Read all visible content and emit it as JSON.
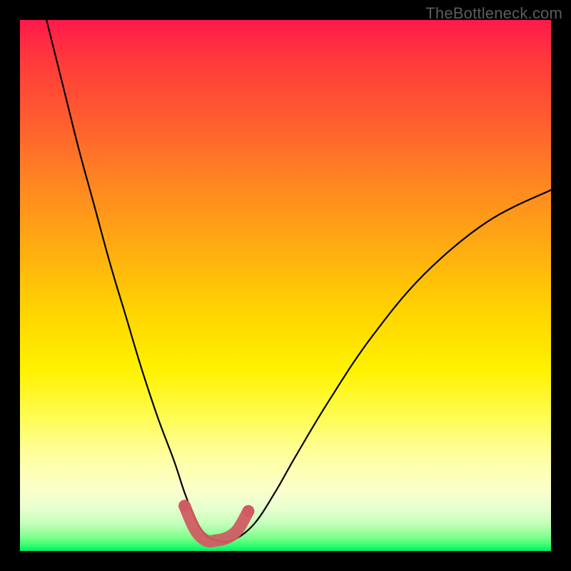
{
  "watermark": "TheBottleneck.com",
  "chart_data": {
    "type": "line",
    "title": "",
    "xlabel": "",
    "ylabel": "",
    "xlim": [
      0,
      100
    ],
    "ylim": [
      0,
      100
    ],
    "grid": false,
    "background_gradient": {
      "top": "#ff1a4b",
      "mid": "#fff200",
      "bottom": "#00e86a"
    },
    "series": [
      {
        "name": "bottleneck-curve",
        "x": [
          5,
          8,
          11,
          14,
          17,
          20,
          23,
          26,
          29,
          31,
          33,
          35,
          37,
          40,
          44,
          48,
          52,
          58,
          66,
          76,
          88,
          100
        ],
        "values": [
          100,
          88,
          76,
          65,
          54,
          44,
          34,
          25,
          17,
          11,
          6,
          3,
          2,
          2,
          5,
          11,
          18,
          28,
          40,
          52,
          62,
          68
        ]
      }
    ],
    "markers": {
      "name": "highlight-valley",
      "x": [
        31,
        33,
        35,
        37,
        39,
        41,
        43
      ],
      "values": [
        8.5,
        4.0,
        2.0,
        2.0,
        2.5,
        4.0,
        7.5
      ]
    }
  }
}
